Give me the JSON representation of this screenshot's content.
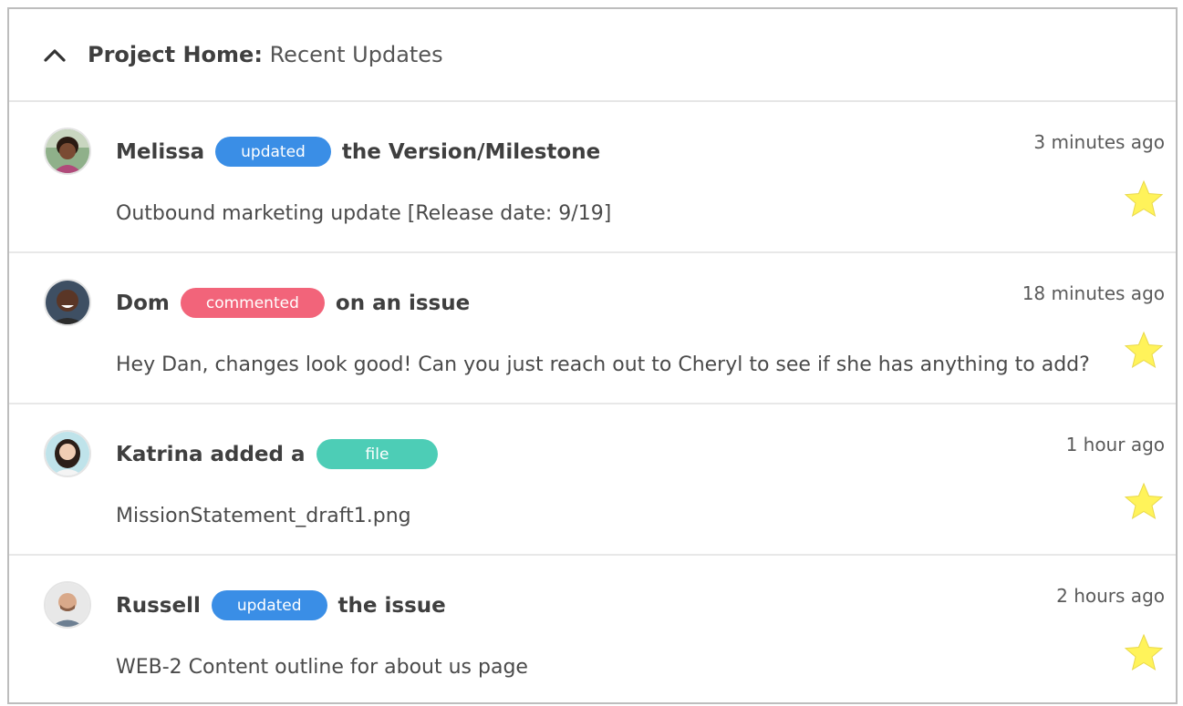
{
  "header": {
    "title_strong": "Project Home:",
    "title_light": "Recent Updates",
    "collapse_icon": "chevron-up-icon"
  },
  "colors": {
    "updated_tag": "#3a8ee6",
    "commented_tag": "#f2647a",
    "file_tag": "#4dcdb6",
    "star": "#fff35a"
  },
  "feed": [
    {
      "user": "Melissa",
      "tag": "updated",
      "action": "the Version/Milestone",
      "detail": "Outbound marketing update [Release date: 9/19]",
      "time": "3 minutes ago",
      "star_icon": "star-icon"
    },
    {
      "user": "Dom",
      "tag": "commented",
      "action": "on an issue",
      "detail": "Hey Dan, changes look good! Can you just reach out to Cheryl to see if she has anything to add?",
      "time": "18 minutes ago",
      "star_icon": "star-icon"
    },
    {
      "user": "Katrina added a",
      "tag": "file",
      "action": "",
      "detail": "MissionStatement_draft1.png",
      "time": "1 hour ago",
      "star_icon": "star-icon"
    },
    {
      "user": "Russell",
      "tag": "updated",
      "action": "the issue",
      "detail": "WEB-2 Content outline for about us page",
      "time": "2 hours ago",
      "star_icon": "star-icon"
    }
  ]
}
